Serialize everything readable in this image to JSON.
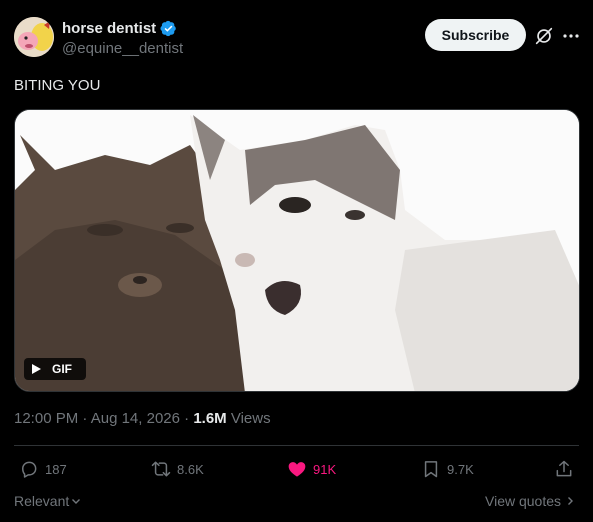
{
  "author": {
    "name": "horse dentist",
    "handle": "@equine__dentist",
    "verified": true
  },
  "header": {
    "subscribe_label": "Subscribe",
    "grok_icon": "grok-icon",
    "more_icon": "more-icon"
  },
  "tweet": {
    "text": "BITING YOU"
  },
  "media": {
    "type": "gif",
    "badge_label": "GIF",
    "description_icon": "play-icon"
  },
  "meta": {
    "time": "12:00 PM",
    "date": "Aug 14, 2026",
    "views_count": "1.6M",
    "views_label": "Views"
  },
  "actions": {
    "replies": "187",
    "reposts": "8.6K",
    "likes": "91K",
    "bookmarks": "9.7K"
  },
  "footer": {
    "sort_label": "Relevant",
    "view_quotes_label": "View quotes"
  },
  "colors": {
    "background": "#000000",
    "text": "#e7e9ea",
    "muted": "#71767b",
    "like": "#f91880",
    "verified": "#1d9bf0"
  }
}
